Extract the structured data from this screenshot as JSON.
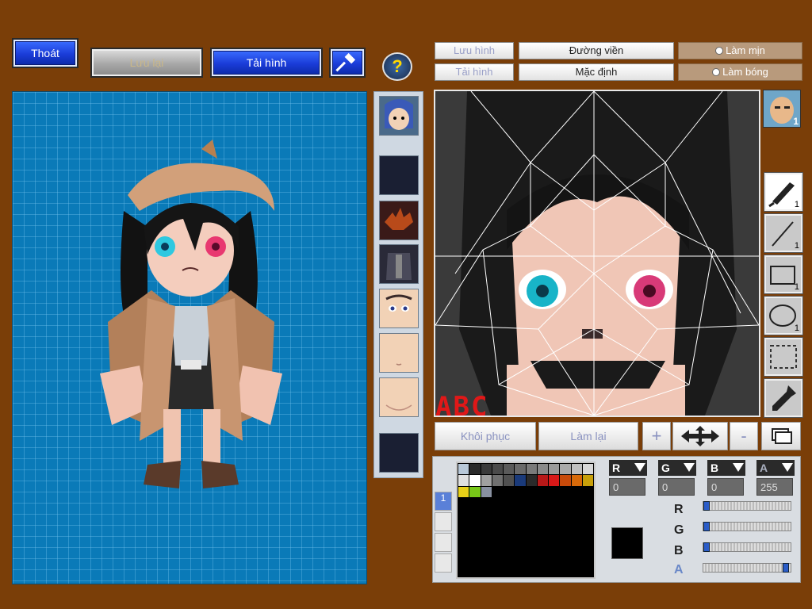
{
  "toolbar": {
    "exit_label": "Thoát",
    "save_label": "Lưu lại",
    "load_label": "Tải hình",
    "help_symbol": "?"
  },
  "editor_tabs": {
    "save_image": "Lưu hình",
    "load_image": "Tải hình",
    "outline": "Đường viền",
    "default": "Mặc định",
    "smooth": "Làm mịn",
    "shade": "Làm bóng"
  },
  "editor": {
    "watermark_text": "ABC"
  },
  "tools": [
    {
      "icon": "brush-icon",
      "count": "1"
    },
    {
      "icon": "line-icon",
      "count": "1"
    },
    {
      "icon": "rectangle-icon",
      "count": "1"
    },
    {
      "icon": "ellipse-icon",
      "count": "1"
    },
    {
      "icon": "selection-icon",
      "count": ""
    },
    {
      "icon": "eyedropper-icon",
      "count": ""
    }
  ],
  "preview_badge": "1",
  "bottom_buttons": {
    "restore": "Khôi phục",
    "redo": "Làm lại",
    "plus": "+",
    "minus": "-"
  },
  "color": {
    "r_label": "R",
    "g_label": "G",
    "b_label": "B",
    "a_label": "A",
    "r": "0",
    "g": "0",
    "b": "0",
    "a": "255",
    "current": "#000000"
  },
  "palette": [
    "#b8c8d8",
    "#2a2a2a",
    "#3a3a3a",
    "#4a4a4a",
    "#5a5a5a",
    "#6a6a6a",
    "#7a7a7a",
    "#8a8a8a",
    "#9a9a9a",
    "#aaaaaa",
    "#c0c0c0",
    "#d8d8d8",
    "#e0e0e0",
    "#ffffff",
    "#a0a0a0",
    "#707070",
    "#505050",
    "#1a3a7a",
    "#2a2a2a",
    "#b81818",
    "#d81818",
    "#c84a0a",
    "#d86a0a",
    "#c8a00a",
    "#e8d018",
    "#78c818",
    "#8890a0"
  ],
  "part_slots": [
    {
      "type": "portrait",
      "icon": "blue-hair-head-icon"
    },
    {
      "type": "empty",
      "icon": ""
    },
    {
      "type": "item",
      "icon": "spiky-fish-icon"
    },
    {
      "type": "item",
      "icon": "dark-armor-icon"
    },
    {
      "type": "face",
      "icon": "face-eyes-icon"
    },
    {
      "type": "face",
      "icon": "face-plain-icon"
    },
    {
      "type": "face",
      "icon": "face-chin-icon"
    },
    {
      "type": "empty",
      "icon": ""
    }
  ],
  "accent_colors": {
    "background": "#7a3e08",
    "canvas_blue": "#0a7ab8",
    "button_blue": "#1a3cd8"
  }
}
